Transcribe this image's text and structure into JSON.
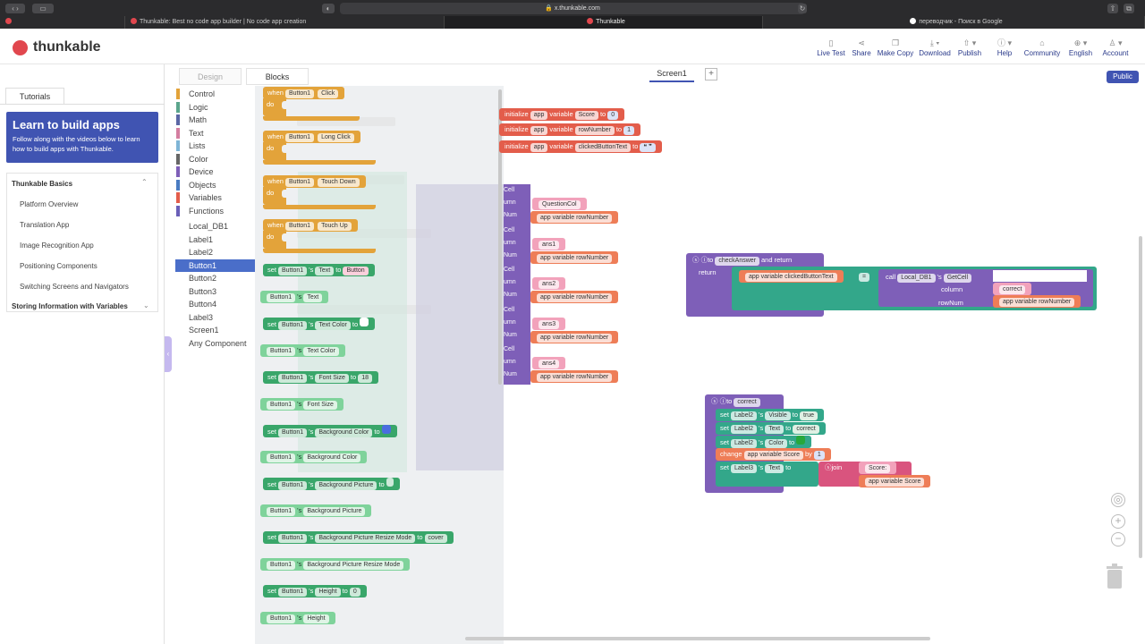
{
  "browser": {
    "url": "x.thunkable.com",
    "tabs": [
      "Thunkable: Best no code app builder | No code app creation",
      "Thunkable",
      "переводчик - Поиск в Google"
    ]
  },
  "header": {
    "logo_text": "thunkable",
    "items": [
      "Live Test",
      "Share",
      "Make Copy",
      "Download",
      "Publish",
      "Help",
      "Community",
      "English",
      "Account"
    ]
  },
  "left": {
    "tab": "Tutorials",
    "learn_title": "Learn to build apps",
    "learn_text": "Follow along with the videos below to learn how to build apps with Thunkable.",
    "section1": "Thunkable Basics",
    "items": [
      "Platform Overview",
      "Translation App",
      "Image Recognition App",
      "Positioning Components",
      "Switching Screens and Navigators"
    ],
    "section2": "Storing Information with Variables"
  },
  "editor_tabs": {
    "design": "Design",
    "blocks": "Blocks"
  },
  "categories": [
    {
      "label": "Control",
      "color": "#e3a33a"
    },
    {
      "label": "Logic",
      "color": "#5ba58c"
    },
    {
      "label": "Math",
      "color": "#5b67a5"
    },
    {
      "label": "Text",
      "color": "#d47ea0"
    },
    {
      "label": "Lists",
      "color": "#7fb5d6"
    },
    {
      "label": "Color",
      "color": "#666666"
    },
    {
      "label": "Device",
      "color": "#7e5fb8"
    },
    {
      "label": "Objects",
      "color": "#4a7cc2"
    },
    {
      "label": "Variables",
      "color": "#e35d4b"
    },
    {
      "label": "Functions",
      "color": "#6a5fb8"
    }
  ],
  "components": [
    "Local_DB1",
    "Label1",
    "Label2",
    "Button1",
    "Button2",
    "Button3",
    "Button4",
    "Label3",
    "Screen1",
    "Any Component"
  ],
  "selected_component": "Button1",
  "flyout": {
    "events": [
      {
        "label": "when",
        "comp": "Button1",
        "event": "Click",
        "do": "do"
      },
      {
        "label": "when",
        "comp": "Button1",
        "event": "Long Click",
        "do": "do"
      },
      {
        "label": "when",
        "comp": "Button1",
        "event": "Touch Down",
        "do": "do"
      },
      {
        "label": "when",
        "comp": "Button1",
        "event": "Touch Up",
        "do": "do"
      }
    ],
    "props": [
      {
        "kind": "set",
        "prop": "Text",
        "value": "Button"
      },
      {
        "kind": "get",
        "prop": "Text"
      },
      {
        "kind": "set",
        "prop": "Text Color",
        "value": ""
      },
      {
        "kind": "get",
        "prop": "Text Color"
      },
      {
        "kind": "set",
        "prop": "Font Size",
        "value": "18"
      },
      {
        "kind": "get",
        "prop": "Font Size"
      },
      {
        "kind": "set",
        "prop": "Background Color",
        "value": ""
      },
      {
        "kind": "get",
        "prop": "Background Color"
      },
      {
        "kind": "set",
        "prop": "Background Picture",
        "value": ""
      },
      {
        "kind": "get",
        "prop": "Background Picture"
      },
      {
        "kind": "set",
        "prop": "Background Picture Resize Mode",
        "value": "cover"
      },
      {
        "kind": "get",
        "prop": "Background Picture Resize Mode"
      },
      {
        "kind": "set",
        "prop": "Height",
        "value": "0"
      },
      {
        "kind": "get",
        "prop": "Height"
      }
    ],
    "comp": "Button1",
    "s_word": "'s",
    "set_word": "set",
    "to_word": "to"
  },
  "canvas": {
    "screen_tab": "Screen1",
    "add": "+",
    "public": "Public",
    "inits": [
      {
        "name": "Score",
        "value": "0"
      },
      {
        "name": "rowNumber",
        "value": "1"
      },
      {
        "name": "clickedButtonText",
        "value": ""
      }
    ],
    "init_words": {
      "init": "initialize",
      "app": "app",
      "variable": "variable",
      "to": "to"
    },
    "getcell_rows": [
      {
        "col": "QuestionCol",
        "row": "app variable rowNumber"
      },
      {
        "col": "ans1",
        "row": "app variable rowNumber"
      },
      {
        "col": "ans2",
        "row": "app variable rowNumber"
      },
      {
        "col": "ans3",
        "row": "app variable rowNumber"
      },
      {
        "col": "ans4",
        "row": "app variable rowNumber"
      }
    ],
    "cell_labels": {
      "cell": "Cell",
      "column": "umn",
      "num": "Num"
    },
    "check": {
      "to": "to",
      "name": "checkAnswer",
      "and_return": "and return",
      "return": "return",
      "var": "app variable clickedButtonText",
      "eq": "=",
      "call": "call",
      "db": "Local_DB1",
      "s": "'s",
      "getcell": "GetCell",
      "column": "column",
      "col_val": "correct",
      "rownum": "rowNum",
      "row_val": "app variable rowNumber"
    },
    "correct": {
      "to": "to",
      "name": "correct",
      "lines": [
        {
          "set": "set",
          "comp": "Label2",
          "s": "'s",
          "prop": "Visible",
          "to": "to",
          "value": "true"
        },
        {
          "set": "set",
          "comp": "Label2",
          "s": "'s",
          "prop": "Text",
          "to": "to",
          "value": "correct"
        },
        {
          "set": "set",
          "comp": "Label2",
          "s": "'s",
          "prop": "Color",
          "to": "to",
          "value": ""
        }
      ],
      "change": "change",
      "change_var": "app variable Score",
      "by": "by",
      "by_val": "1",
      "last": {
        "set": "set",
        "comp": "Label3",
        "s": "'s",
        "prop": "Text",
        "to": "to",
        "join": "join",
        "str": "Score:",
        "var": "app variable Score"
      }
    }
  },
  "colors": {
    "brand": "#e1474e",
    "accent": "#4054b2"
  }
}
